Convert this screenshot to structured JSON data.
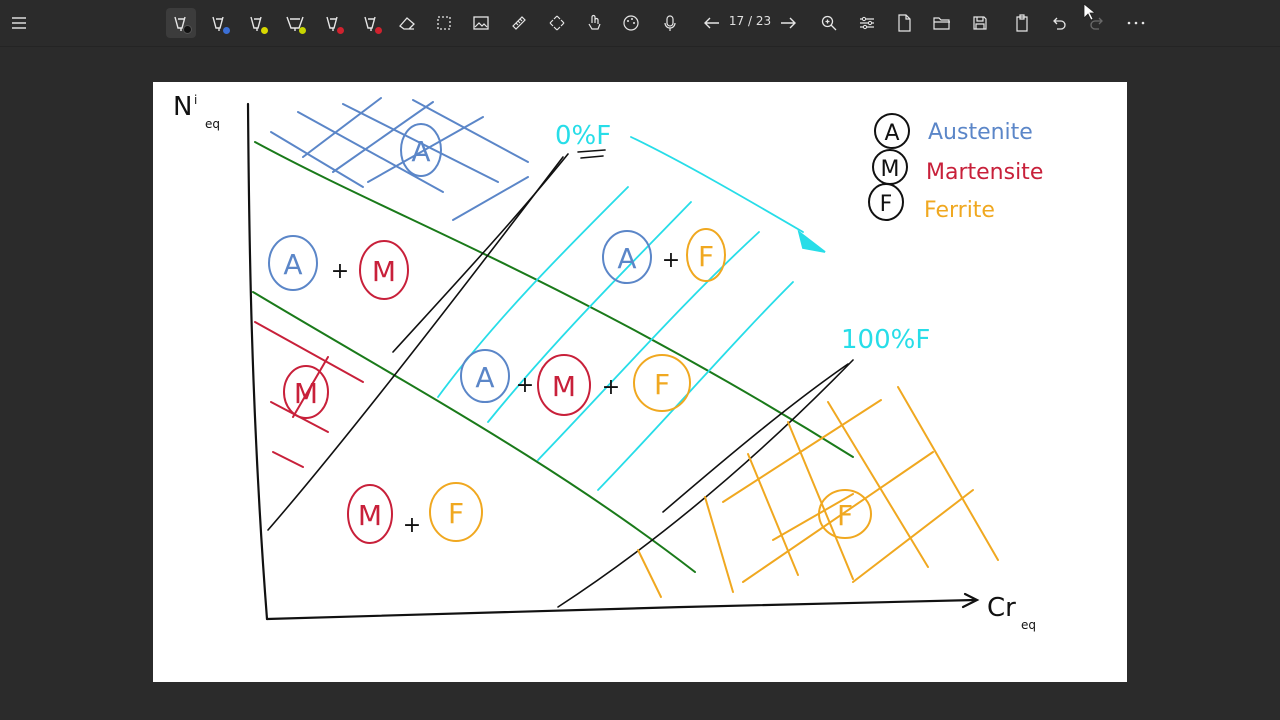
{
  "toolbar": {
    "page_current": "17",
    "page_total": "23",
    "page_indicator": "17 / 23",
    "pen_colors": [
      "#111111",
      "#3b6fd6",
      "#d8d800",
      "#c6d400",
      "#d0222e",
      "#d0222e"
    ]
  },
  "diagram": {
    "axis_y_label": "N",
    "axis_y_sub": "eq",
    "axis_y_sup": "i",
    "axis_x_label": "Cr",
    "axis_x_sub": "eq",
    "label_0F": "0%F",
    "label_100F": "100%F",
    "legend": [
      {
        "symbol": "A",
        "text": "Austenite",
        "color": "#5b86c8"
      },
      {
        "symbol": "M",
        "text": "Martensite",
        "color": "#c8203a"
      },
      {
        "symbol": "F",
        "text": "Ferrite",
        "color": "#f0a820"
      }
    ],
    "regions": {
      "austenite": "A",
      "a_plus_m": [
        "A",
        "+",
        "M"
      ],
      "a_plus_f": [
        "A",
        "+",
        "F"
      ],
      "a_m_f": [
        "A",
        "+",
        "M",
        "+",
        "F"
      ],
      "martensite": "M",
      "m_plus_f": [
        "M",
        "+",
        "F"
      ],
      "ferrite": "F"
    },
    "colors": {
      "austenite": "#5b86c8",
      "martensite": "#c8203a",
      "ferrite": "#f0a820",
      "boundary": "#1a7a1a",
      "cyan": "#27dde8",
      "ink": "#111111"
    }
  }
}
